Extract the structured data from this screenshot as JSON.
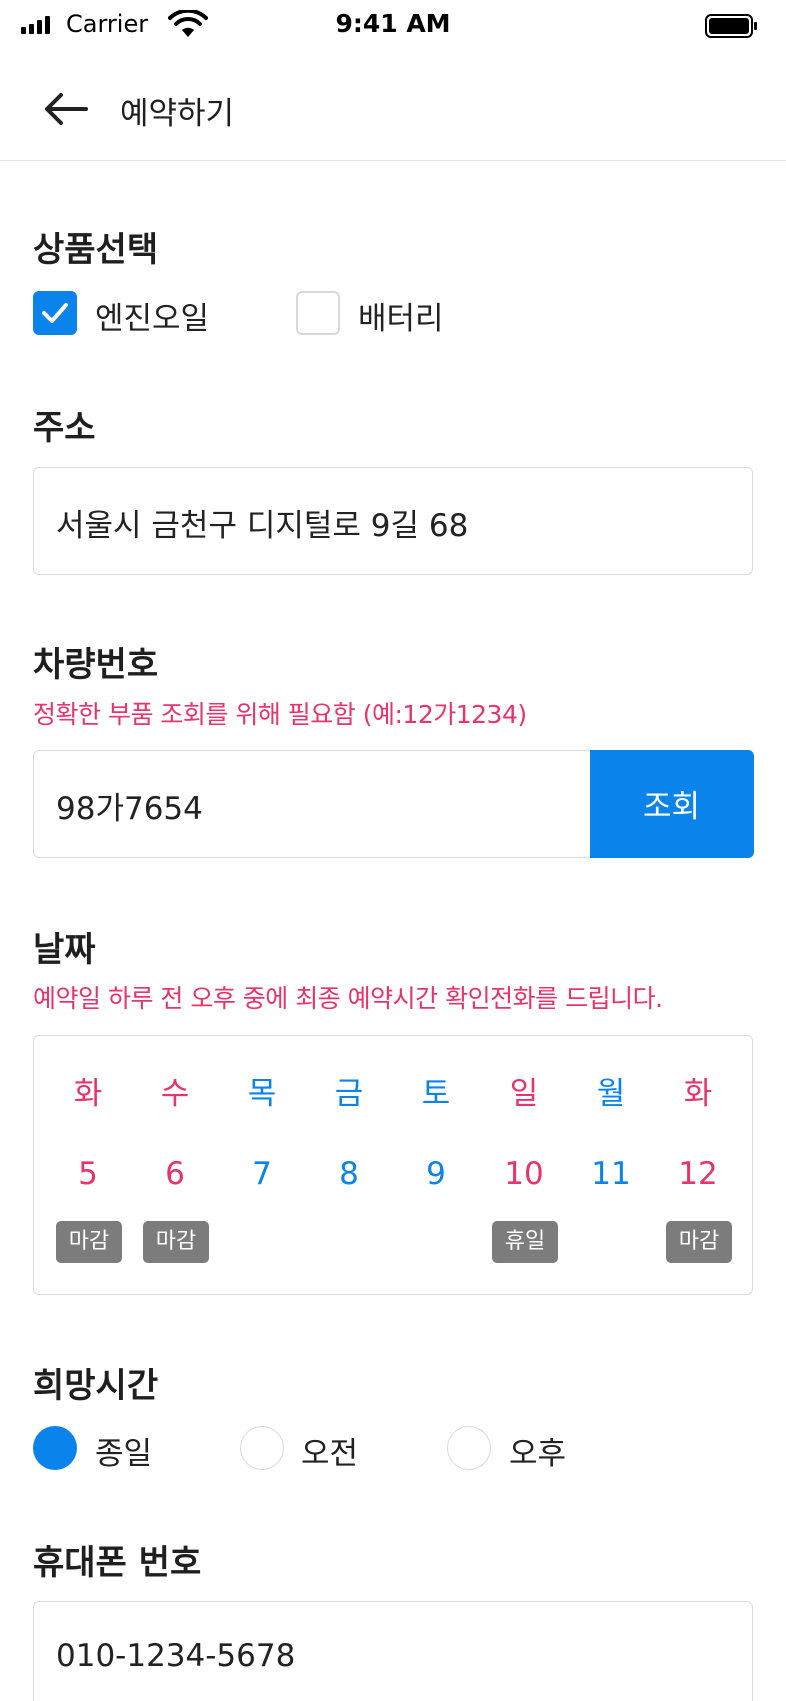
{
  "status_bar": {
    "carrier": "Carrier",
    "time": "9:41 AM"
  },
  "header": {
    "title": "예약하기"
  },
  "product": {
    "title": "상품선택",
    "options": [
      {
        "label": "엔진오일",
        "checked": true
      },
      {
        "label": "배터리",
        "checked": false
      }
    ]
  },
  "address": {
    "title": "주소",
    "value": "서울시 금천구 디지털로 9길 68"
  },
  "vehicle": {
    "title": "차량번호",
    "hint": "정확한 부품 조회를 위해 필요함 (예:12가1234)",
    "value": "98가7654",
    "lookup_label": "조회"
  },
  "date": {
    "title": "날짜",
    "hint": "예약일 하루 전 오후 중에 최종 예약시간 확인전화를 드립니다.",
    "days": [
      {
        "dow": "화",
        "date": "5",
        "badge": "마감",
        "color": "red"
      },
      {
        "dow": "수",
        "date": "6",
        "badge": "마감",
        "color": "red"
      },
      {
        "dow": "목",
        "date": "7",
        "badge": "",
        "color": "blue"
      },
      {
        "dow": "금",
        "date": "8",
        "badge": "",
        "color": "blue"
      },
      {
        "dow": "토",
        "date": "9",
        "badge": "",
        "color": "blue"
      },
      {
        "dow": "일",
        "date": "10",
        "badge": "휴일",
        "color": "red"
      },
      {
        "dow": "월",
        "date": "11",
        "badge": "",
        "color": "blue"
      },
      {
        "dow": "화",
        "date": "12",
        "badge": "마감",
        "color": "red"
      }
    ]
  },
  "time_pref": {
    "title": "희망시간",
    "options": [
      {
        "label": "종일",
        "selected": true
      },
      {
        "label": "오전",
        "selected": false
      },
      {
        "label": "오후",
        "selected": false
      }
    ]
  },
  "phone": {
    "title": "휴대폰 번호",
    "value": "010-1234-5678"
  },
  "colors": {
    "accent": "#0a84ea",
    "warning": "#e8336b",
    "badge": "#7c7c7c"
  }
}
